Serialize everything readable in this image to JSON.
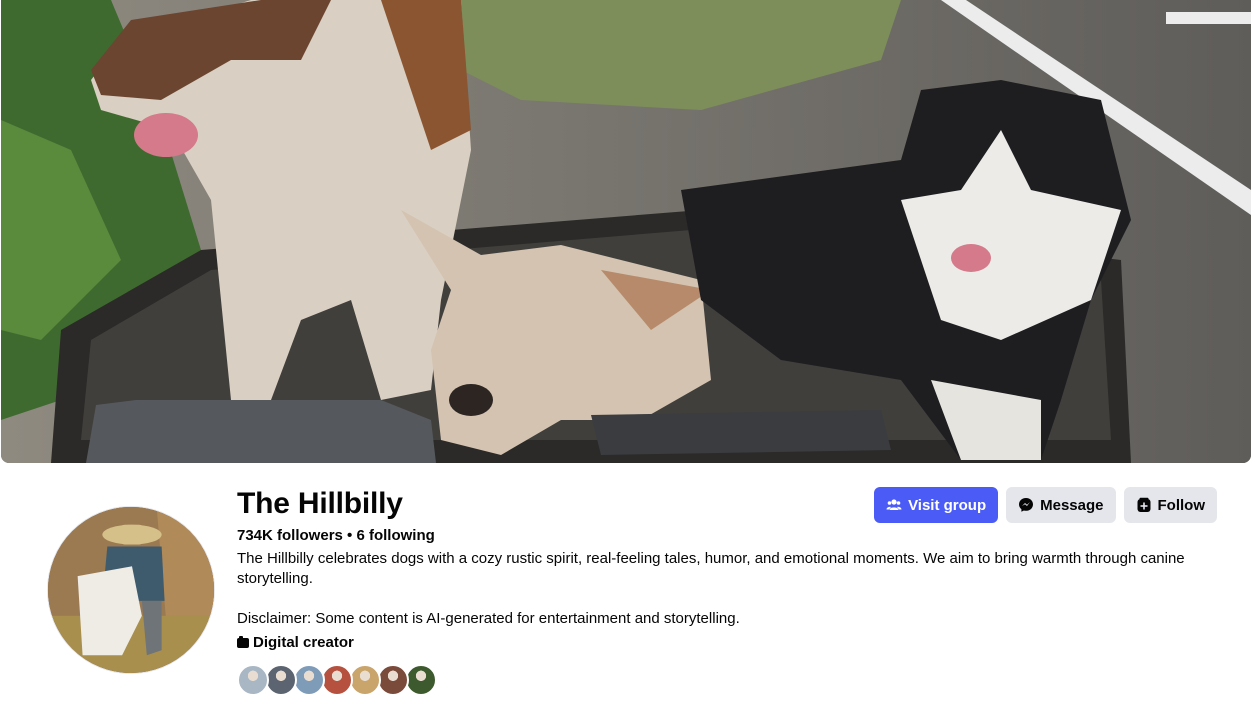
{
  "cover": {
    "image": "cover-photo-dogs-on-atv"
  },
  "profile": {
    "name": "The Hillbilly",
    "stats": "734K followers • 6 following",
    "bio_line1": "The Hillbilly celebrates dogs with a cozy rustic spirit, real-feeling tales, humor, and emotional moments. We aim to bring warmth through canine storytelling.",
    "bio_line2": "Disclaimer: Some content is AI-generated for entertainment and storytelling.",
    "category": "Digital creator",
    "category_icon": "briefcase-icon"
  },
  "actions": {
    "visit_group": "Visit group",
    "visit_group_icon": "group-icon",
    "message": "Message",
    "message_icon": "messenger-icon",
    "follow": "Follow",
    "follow_icon": "follow-plus-icon"
  },
  "followers_preview": {
    "count_shown": 7,
    "colors": [
      "#a9b7c4",
      "#5b6470",
      "#7e9bb8",
      "#b5513e",
      "#c9a46b",
      "#7a4a3a",
      "#3d5a2e"
    ]
  },
  "colors": {
    "primary_button": "#4b5cf6",
    "secondary_button": "#e4e6eb"
  }
}
